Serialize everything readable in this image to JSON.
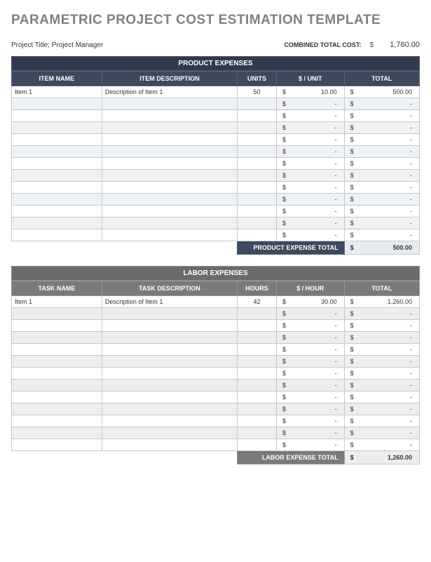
{
  "title": "PARAMETRIC PROJECT COST ESTIMATION TEMPLATE",
  "meta": {
    "project_line": "Project Title; Project Manager",
    "combined_label": "COMBINED TOTAL COST:",
    "combined_dollar": "$",
    "combined_amount": "1,760.00"
  },
  "product": {
    "section_title": "PRODUCT EXPENSES",
    "headers": {
      "name": "ITEM NAME",
      "desc": "ITEM DESCRIPTION",
      "units": "UNITS",
      "rate": "$ / UNIT",
      "total": "TOTAL"
    },
    "rows": [
      {
        "name": "Item 1",
        "desc": "Description of Item 1",
        "units": "50",
        "rate": "10.00",
        "total": "500.00"
      },
      {
        "name": "",
        "desc": "",
        "units": "",
        "rate": "-",
        "total": "-"
      },
      {
        "name": "",
        "desc": "",
        "units": "",
        "rate": "-",
        "total": "-"
      },
      {
        "name": "",
        "desc": "",
        "units": "",
        "rate": "-",
        "total": "-"
      },
      {
        "name": "",
        "desc": "",
        "units": "",
        "rate": "-",
        "total": "-"
      },
      {
        "name": "",
        "desc": "",
        "units": "",
        "rate": "-",
        "total": "-"
      },
      {
        "name": "",
        "desc": "",
        "units": "",
        "rate": "-",
        "total": "-"
      },
      {
        "name": "",
        "desc": "",
        "units": "",
        "rate": "-",
        "total": "-"
      },
      {
        "name": "",
        "desc": "",
        "units": "",
        "rate": "-",
        "total": "-"
      },
      {
        "name": "",
        "desc": "",
        "units": "",
        "rate": "-",
        "total": "-"
      },
      {
        "name": "",
        "desc": "",
        "units": "",
        "rate": "-",
        "total": "-"
      },
      {
        "name": "",
        "desc": "",
        "units": "",
        "rate": "-",
        "total": "-"
      },
      {
        "name": "",
        "desc": "",
        "units": "",
        "rate": "-",
        "total": "-"
      }
    ],
    "total_label": "PRODUCT EXPENSE TOTAL",
    "total_value": "500.00",
    "dollar": "$"
  },
  "labor": {
    "section_title": "LABOR EXPENSES",
    "headers": {
      "name": "TASK NAME",
      "desc": "TASK DESCRIPTION",
      "units": "HOURS",
      "rate": "$ / HOUR",
      "total": "TOTAL"
    },
    "rows": [
      {
        "name": "Item 1",
        "desc": "Description of Item 1",
        "units": "42",
        "rate": "30.00",
        "total": "1,260.00"
      },
      {
        "name": "",
        "desc": "",
        "units": "",
        "rate": "-",
        "total": "-"
      },
      {
        "name": "",
        "desc": "",
        "units": "",
        "rate": "-",
        "total": "-"
      },
      {
        "name": "",
        "desc": "",
        "units": "",
        "rate": "-",
        "total": "-"
      },
      {
        "name": "",
        "desc": "",
        "units": "",
        "rate": "-",
        "total": "-"
      },
      {
        "name": "",
        "desc": "",
        "units": "",
        "rate": "-",
        "total": "-"
      },
      {
        "name": "",
        "desc": "",
        "units": "",
        "rate": "-",
        "total": "-"
      },
      {
        "name": "",
        "desc": "",
        "units": "",
        "rate": "-",
        "total": "-"
      },
      {
        "name": "",
        "desc": "",
        "units": "",
        "rate": "-",
        "total": "-"
      },
      {
        "name": "",
        "desc": "",
        "units": "",
        "rate": "-",
        "total": "-"
      },
      {
        "name": "",
        "desc": "",
        "units": "",
        "rate": "-",
        "total": "-"
      },
      {
        "name": "",
        "desc": "",
        "units": "",
        "rate": "-",
        "total": "-"
      },
      {
        "name": "",
        "desc": "",
        "units": "",
        "rate": "-",
        "total": "-"
      }
    ],
    "total_label": "LABOR EXPENSE TOTAL",
    "total_value": "1,260.00",
    "dollar": "$"
  }
}
